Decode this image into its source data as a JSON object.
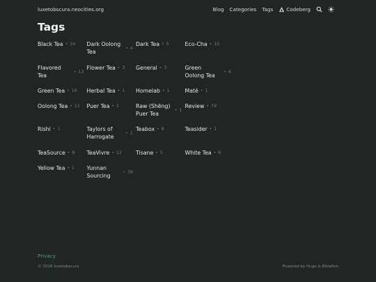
{
  "header": {
    "site_title": "luxetobscura.neocities.org",
    "nav": {
      "blog": "Blog",
      "categories": "Categories",
      "tags": "Tags",
      "codeberg": "Codeberg"
    }
  },
  "page_title": "Tags",
  "tags": [
    {
      "name": "Black Tea",
      "count": "34"
    },
    {
      "name": "Dark Oolong Tea",
      "count": "4"
    },
    {
      "name": "Dark Tea",
      "count": "5"
    },
    {
      "name": "Eco-Cha",
      "count": "10"
    },
    {
      "name": "Flavored Tea",
      "count": "13"
    },
    {
      "name": "Flower Tea",
      "count": "3"
    },
    {
      "name": "General",
      "count": "3"
    },
    {
      "name": "Green Oolong Tea",
      "count": "6"
    },
    {
      "name": "Green Tea",
      "count": "16"
    },
    {
      "name": "Herbal Tea",
      "count": "1"
    },
    {
      "name": "Homelab",
      "count": "1"
    },
    {
      "name": "Maté",
      "count": "1"
    },
    {
      "name": "Oolong Tea",
      "count": "11"
    },
    {
      "name": "Puer Tea",
      "count": "1"
    },
    {
      "name": "Raw (Shēng) Puer Tea",
      "count": "1"
    },
    {
      "name": "Review",
      "count": "79"
    },
    {
      "name": "Rishi",
      "count": "1"
    },
    {
      "name": "Taylors of Harrogate",
      "count": "1"
    },
    {
      "name": "Teabox",
      "count": "8"
    },
    {
      "name": "Teasider",
      "count": "1"
    },
    {
      "name": "TeaSource",
      "count": "8"
    },
    {
      "name": "TeaVivre",
      "count": "12"
    },
    {
      "name": "Tisane",
      "count": "5"
    },
    {
      "name": "White Tea",
      "count": "6"
    },
    {
      "name": "Yellow Tea",
      "count": "1"
    },
    {
      "name": "Yunnan Sourcing",
      "count": "38"
    }
  ],
  "footer": {
    "privacy": "Privacy",
    "copyright": "© 2026 luxetobscura",
    "powered": "Powered by Hugo & Blowfish"
  },
  "colors": {
    "background": "#1f2624",
    "accent": "#5f9584",
    "muted": "#6f7d78"
  },
  "icons": [
    "codeberg-icon",
    "search-icon",
    "theme-toggle-icon"
  ]
}
